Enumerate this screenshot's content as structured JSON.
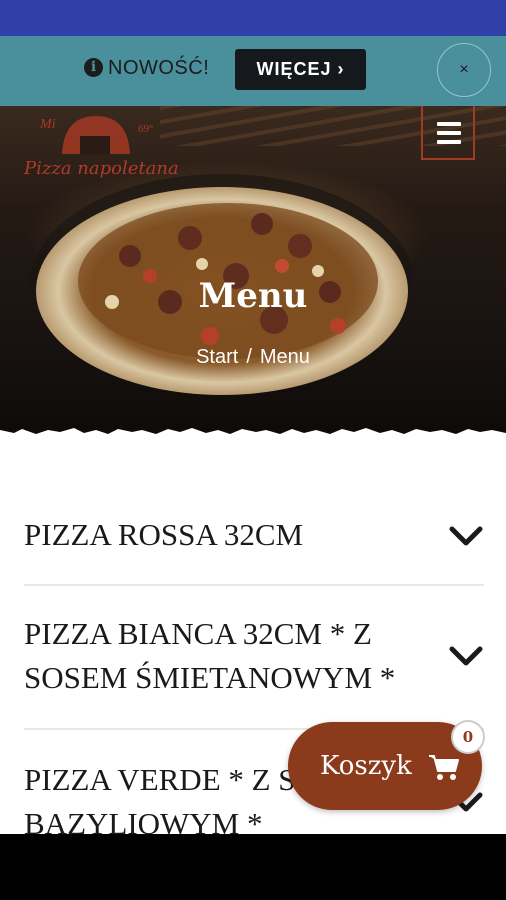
{
  "notice": {
    "label": "NOWOŚĆ!",
    "button": "WIĘCEJ ›",
    "close": "×"
  },
  "logo": {
    "text": "Pizza napoletana"
  },
  "hero": {
    "title": "Menu",
    "breadcrumb": [
      "Start",
      "/",
      "Menu"
    ]
  },
  "menu": {
    "items": [
      {
        "title": "PIZZA ROSSA 32CM"
      },
      {
        "title": "PIZZA BIANCA 32CM * Z SOSEM ŚMIETANOWYM *"
      },
      {
        "title": "PIZZA VERDE * Z SOSEM BAZYLIOWYM *"
      }
    ]
  },
  "cart": {
    "label": "Koszyk",
    "count": "0",
    "icon": "cart-icon"
  },
  "colors": {
    "status_bar": "#2f40a8",
    "notice_bg": "#4a8f9c",
    "accent": "#8c3a1c",
    "button_dark": "#15181c"
  }
}
